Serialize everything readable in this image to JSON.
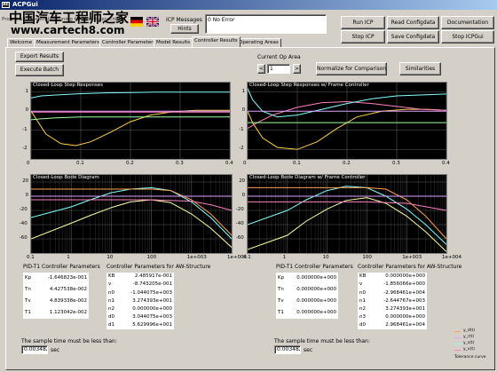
{
  "window": {
    "title": "ACPGui",
    "heading": "Program for controller tuning for User interaction"
  },
  "watermark": {
    "line1": "中国汽车工程师之家",
    "line2": "www.cartech8.com"
  },
  "icp": {
    "label1": "ICP Messages",
    "hints": "Hints",
    "status": "0 No Error"
  },
  "buttons": {
    "run_icp": "Run ICP",
    "read_config": "Read Configdata",
    "documentation": "Documentation",
    "stop_icp": "Stop ICP",
    "save_config": "Save Configdata",
    "stop_icpgui": "Stop ICPGui",
    "export": "Export Results",
    "execute": "Execute Batch",
    "normalize": "Normalize for Comparison",
    "similarities": "Similarities"
  },
  "tabs": [
    "Welcome",
    "Measurement Parameters",
    "Controller Parameters",
    "Model Results",
    "Controller Results",
    "Operating Areas"
  ],
  "active_tab": 4,
  "op_area": {
    "label": "Current Op Area",
    "value": "1",
    "prev": "<",
    "next": ">"
  },
  "pid_left": {
    "title": "PID-T1 Controller Parameters",
    "rows": [
      [
        "Kp",
        "-1.646823e-001"
      ],
      [
        "Tn",
        "4.427538e-002"
      ],
      [
        "Tv",
        "4.839338e-002"
      ],
      [
        "T1",
        "1.123042e-002"
      ]
    ]
  },
  "aw_left": {
    "title": "Controller Parameters for AW-Structure",
    "rows": [
      [
        "KB",
        "2.485917e-001"
      ],
      [
        "v",
        "-8.743205e-001"
      ],
      [
        "n0",
        "-1.044075e+003"
      ],
      [
        "n1",
        "3.274393e+001"
      ],
      [
        "n2",
        "0.000000e+000"
      ],
      [
        "d0",
        "3.044075e+003"
      ],
      [
        "d1",
        "5.629996e+001"
      ]
    ]
  },
  "pid_right": {
    "title": "PID-T1 Controller Parameters",
    "rows": [
      [
        "Kp",
        "0.000000e+000"
      ],
      [
        "Tn",
        "0.000000e+000"
      ],
      [
        "Tv",
        "0.000000e+000"
      ],
      [
        "T1",
        "0.000000e+000"
      ]
    ]
  },
  "aw_right": {
    "title": "Controller Parameters for AW-Structure",
    "rows": [
      [
        "KB",
        "0.000000e+000"
      ],
      [
        "v",
        "-1.856066e+000"
      ],
      [
        "n0",
        "-2.968461e+004"
      ],
      [
        "n1",
        "-2.644767e+003"
      ],
      [
        "n2",
        "3.274393e+001"
      ],
      [
        "n3",
        "0.000000e+000"
      ],
      [
        "d0",
        "2.968461e+004"
      ]
    ]
  },
  "sample_left": {
    "text": "The sample time must be less than:",
    "value": "0.0034827",
    "unit": "sec"
  },
  "sample_right": {
    "text": "The sample time must be less than:",
    "value": "0.0034827",
    "unit": "sec"
  },
  "legend": {
    "items": [
      {
        "label": "y_d(t)",
        "color": "#ffa050"
      },
      {
        "label": "y_r(t)",
        "color": "#e0a0ff"
      },
      {
        "label": "y_s(t)",
        "color": "#80ffff"
      },
      {
        "label": "y_x(t)",
        "color": "#ff80c0"
      }
    ],
    "extra": "Tolerance curve"
  },
  "chart_data": [
    {
      "type": "line",
      "title": "Closed-Loop Step Responses",
      "xlim": [
        0,
        0.4
      ],
      "xticks": [
        "0",
        "0.1",
        "0.2",
        "0.3",
        "0.4"
      ],
      "yticks": [
        "1",
        "0",
        "-1",
        "-2"
      ],
      "ylim": [
        -2.5,
        1.5
      ],
      "series": [
        {
          "color": "#ffd24a",
          "x": [
            0,
            0.01,
            0.03,
            0.06,
            0.09,
            0.12,
            0.16,
            0.2,
            0.24,
            0.28,
            0.33,
            0.38,
            0.4
          ],
          "y": [
            0,
            -0.4,
            -1.2,
            -1.7,
            -1.8,
            -1.6,
            -1.1,
            -0.55,
            -0.2,
            -0.05,
            0.05,
            0.05,
            0.05
          ]
        },
        {
          "color": "#80ffff",
          "x": [
            0,
            0.02,
            0.05,
            0.1,
            0.15,
            0.2,
            0.25,
            0.3,
            0.35,
            0.4
          ],
          "y": [
            0.7,
            0.8,
            0.85,
            0.92,
            0.96,
            0.98,
            1,
            1,
            1,
            1
          ]
        },
        {
          "color": "#a0ffa0",
          "x": [
            0,
            0.02,
            0.05,
            0.1,
            0.2,
            0.3,
            0.4
          ],
          "y": [
            -0.45,
            -0.4,
            -0.35,
            -0.3,
            -0.3,
            -0.3,
            -0.3
          ]
        },
        {
          "color": "#e0a0ff",
          "x": [
            0,
            0.4
          ],
          "y": [
            0,
            0
          ]
        },
        {
          "color": "#ff80c0",
          "x": [
            0,
            0.4
          ],
          "y": [
            -0.05,
            -0.05
          ]
        }
      ]
    },
    {
      "type": "line",
      "title": "Closed-Loop Step Responses w/ Frame Controller",
      "xlim": [
        0,
        0.4
      ],
      "xticks": [
        "0",
        "0.1",
        "0.2",
        "0.3",
        "0.4"
      ],
      "yticks": [
        "1",
        "0",
        "-1",
        "-2"
      ],
      "ylim": [
        -2.5,
        1.5
      ],
      "series": [
        {
          "color": "#ffd24a",
          "x": [
            0,
            0.01,
            0.03,
            0.06,
            0.1,
            0.14,
            0.18,
            0.22,
            0.27,
            0.32,
            0.36,
            0.4
          ],
          "y": [
            0,
            -0.6,
            -1.4,
            -1.9,
            -2.0,
            -1.6,
            -0.9,
            -0.3,
            0,
            0.1,
            0.1,
            0.05
          ]
        },
        {
          "color": "#ff80c0",
          "x": [
            0,
            0.02,
            0.05,
            0.1,
            0.15,
            0.2,
            0.25,
            0.3,
            0.35,
            0.4
          ],
          "y": [
            -0.9,
            -0.6,
            -0.2,
            0.2,
            0.45,
            0.5,
            0.4,
            0.25,
            0.1,
            0.05
          ]
        },
        {
          "color": "#80ffff",
          "x": [
            0,
            0.01,
            0.03,
            0.06,
            0.1,
            0.15,
            0.2,
            0.25,
            0.3,
            0.4
          ],
          "y": [
            1.2,
            0.6,
            0,
            -0.3,
            -0.2,
            0.1,
            0.4,
            0.65,
            0.8,
            0.9
          ]
        },
        {
          "color": "#a0ffa0",
          "x": [
            0,
            0.4
          ],
          "y": [
            -0.6,
            -0.6
          ]
        },
        {
          "color": "#e0a0ff",
          "x": [
            0,
            0.4
          ],
          "y": [
            0,
            0
          ]
        }
      ]
    },
    {
      "type": "line",
      "title": "Closed-Loop Bode Diagram",
      "xscale": "log",
      "xlim": [
        0.1,
        10000
      ],
      "xticks": [
        "0.1",
        "1",
        "10",
        "100",
        "1e+003",
        "1e+004"
      ],
      "yticks": [
        "20",
        "0",
        "-20",
        "-40",
        "-60"
      ],
      "ylim": [
        -80,
        30
      ],
      "series": [
        {
          "color": "#ffffa0",
          "x": [
            0.1,
            1,
            3,
            10,
            30,
            100,
            300,
            1000,
            3000,
            10000
          ],
          "y": [
            -60,
            -38,
            -27,
            -16,
            -8,
            -5,
            -9,
            -25,
            -45,
            -72
          ]
        },
        {
          "color": "#80ffff",
          "x": [
            0.1,
            1,
            3,
            10,
            30,
            100,
            300,
            1000,
            3000,
            10000
          ],
          "y": [
            -30,
            -15,
            -5,
            5,
            10,
            12,
            8,
            -8,
            -30,
            -60
          ]
        },
        {
          "color": "#ffa050",
          "x": [
            0.1,
            1,
            10,
            100,
            300,
            1000,
            3000,
            10000
          ],
          "y": [
            10,
            10,
            10,
            10,
            8,
            -5,
            -25,
            -55
          ]
        },
        {
          "color": "#ff80c0",
          "x": [
            0.1,
            1,
            10,
            100,
            1000,
            3000,
            10000
          ],
          "y": [
            -5,
            -5,
            -5,
            -5,
            -7,
            -12,
            -20
          ]
        },
        {
          "color": "#e0a0ff",
          "x": [
            0.1,
            1,
            10,
            100,
            1000,
            10000
          ],
          "y": [
            0,
            0,
            0,
            0,
            0,
            0
          ]
        }
      ]
    },
    {
      "type": "line",
      "title": "Closed-Loop Bode Diagram w/ Frame Controller",
      "xscale": "log",
      "xlim": [
        0.1,
        10000
      ],
      "xticks": [
        "0.1",
        "1",
        "10",
        "100",
        "1e+003",
        "1e+004"
      ],
      "yticks": [
        "20",
        "0",
        "-20",
        "-40",
        "-60"
      ],
      "ylim": [
        -80,
        30
      ],
      "series": [
        {
          "color": "#ffffa0",
          "x": [
            0.1,
            1,
            3,
            10,
            30,
            100,
            300,
            1000,
            3000,
            10000
          ],
          "y": [
            -75,
            -55,
            -35,
            -18,
            -6,
            -2,
            -10,
            -28,
            -50,
            -78
          ]
        },
        {
          "color": "#80ffff",
          "x": [
            0.1,
            1,
            3,
            10,
            30,
            100,
            300,
            1000,
            3000,
            10000
          ],
          "y": [
            -40,
            -20,
            -5,
            8,
            14,
            12,
            0,
            -18,
            -40,
            -68
          ]
        },
        {
          "color": "#ffa050",
          "x": [
            0.1,
            1,
            10,
            100,
            300,
            1000,
            3000,
            10000
          ],
          "y": [
            12,
            12,
            12,
            12,
            10,
            -5,
            -28,
            -60
          ]
        },
        {
          "color": "#ff80c0",
          "x": [
            0.1,
            1,
            10,
            100,
            1000,
            10000
          ],
          "y": [
            -8,
            -8,
            -8,
            -8,
            -10,
            -20
          ]
        },
        {
          "color": "#e0a0ff",
          "x": [
            0.1,
            10000
          ],
          "y": [
            0,
            0
          ]
        }
      ]
    }
  ]
}
